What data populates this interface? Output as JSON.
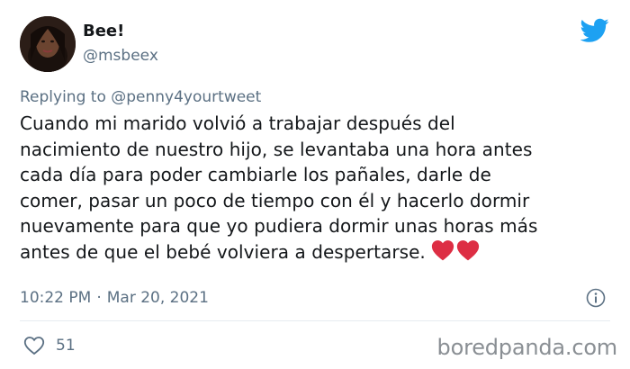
{
  "user": {
    "name": "Bee!",
    "handle": "@msbeex"
  },
  "reply": {
    "prefix": "Replying to",
    "to": "@penny4yourtweet"
  },
  "tweet": {
    "lines": [
      "Cuando mi marido volvió a trabajar después del",
      "nacimiento de nuestro hijo, se levantaba una hora antes",
      "cada día para poder cambiarle los pañales, darle de",
      "comer, pasar un poco de tiempo con él y hacerlo dormir",
      "nuevamente para que yo pudiera dormir unas horas más",
      "antes de que el bebé volviera a despertarse."
    ],
    "emoji": [
      "red-heart-icon",
      "red-heart-icon"
    ]
  },
  "meta": {
    "time": "10:22 PM",
    "separator": "·",
    "date": "Mar 20, 2021"
  },
  "stats": {
    "likes": "51"
  },
  "watermark": "boredpanda.com",
  "colors": {
    "twitter_blue": "#1da1f2",
    "heart_red": "#dd2e44",
    "secondary_text": "#5b7083",
    "primary_text": "#14171a",
    "watermark": "#8a8f94"
  }
}
